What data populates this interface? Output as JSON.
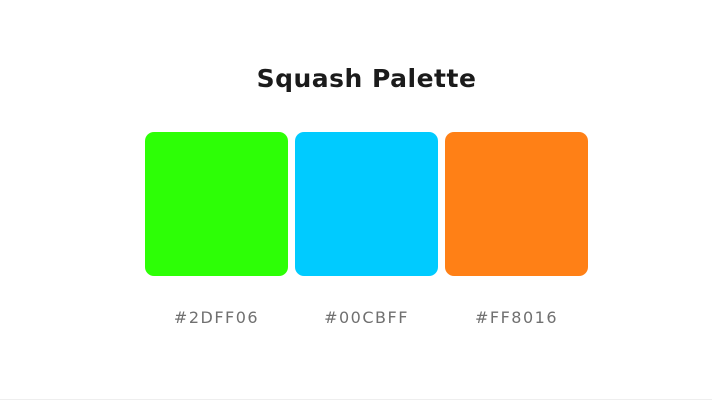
{
  "palette": {
    "title": "Squash Palette",
    "colors": [
      {
        "hex": "#2DFF06",
        "label": "#2DFF06"
      },
      {
        "hex": "#00CBFF",
        "label": "#00CBFF"
      },
      {
        "hex": "#FF8016",
        "label": "#FF8016"
      }
    ]
  }
}
